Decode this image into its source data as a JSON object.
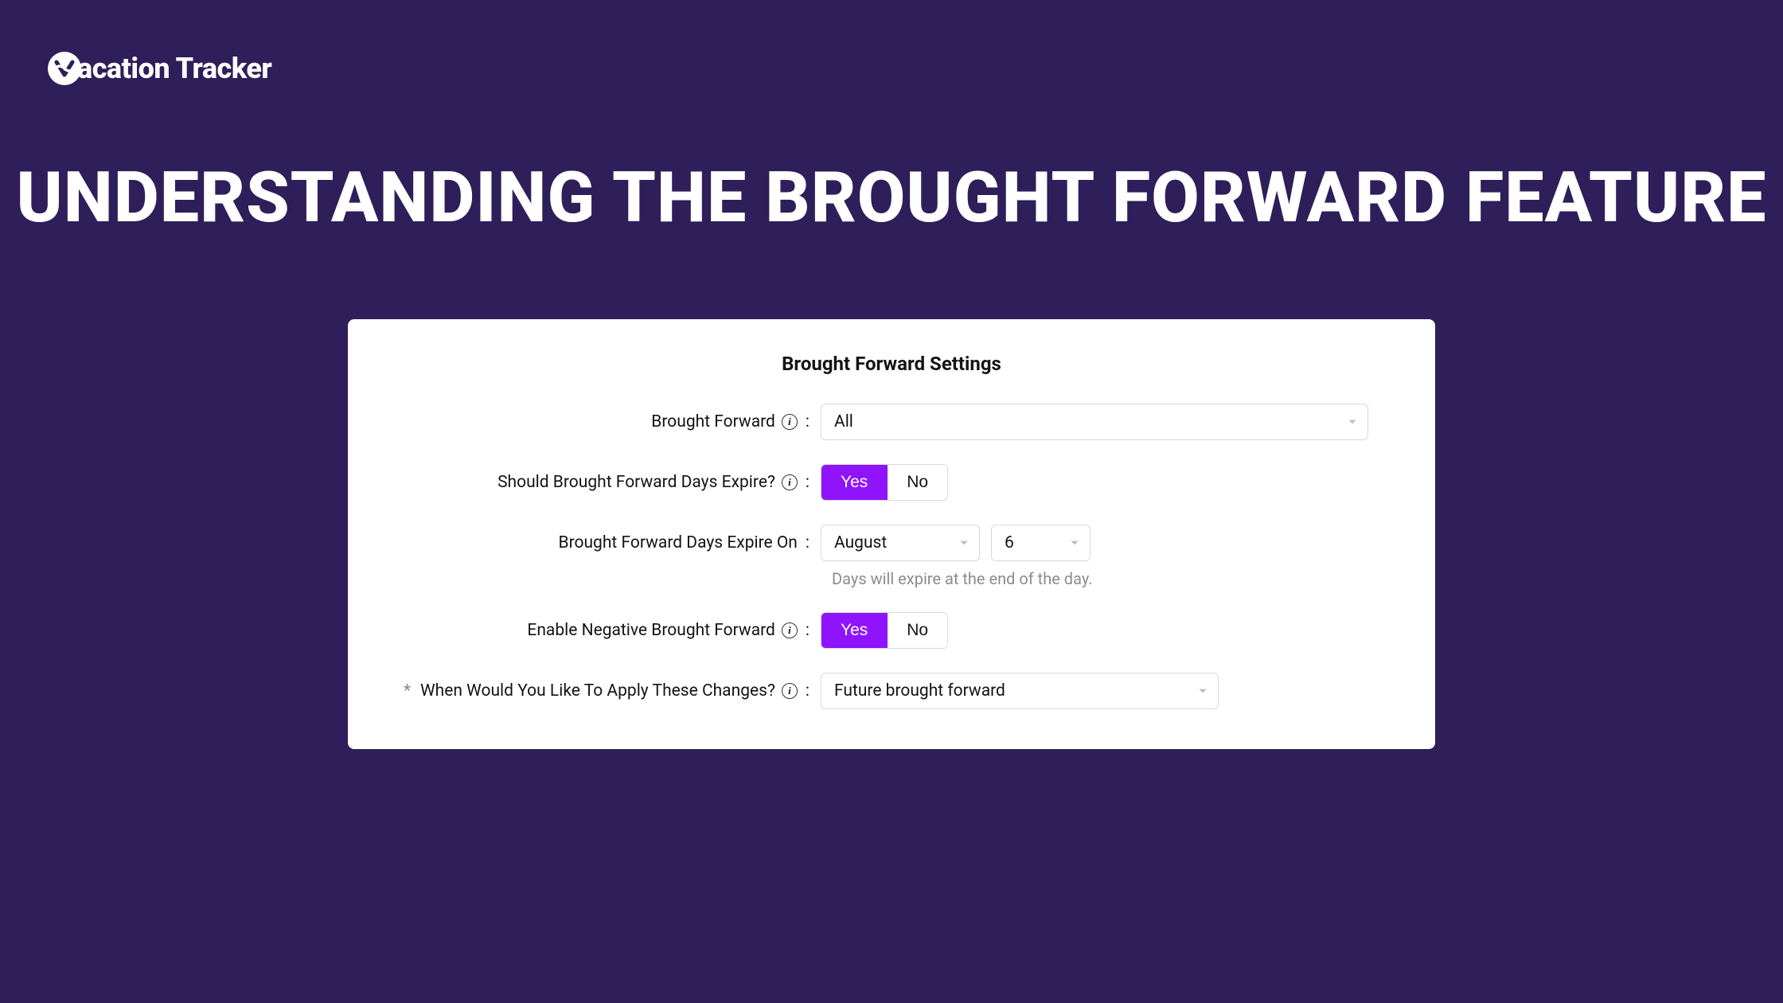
{
  "brand": {
    "name": "acation Tracker"
  },
  "title": "UNDERSTANDING THE BROUGHT FORWARD FEATURE",
  "card": {
    "heading": "Brought Forward Settings",
    "rows": {
      "broughtForward": {
        "label": "Brought Forward",
        "value": "All"
      },
      "shouldExpire": {
        "label": "Should Brought Forward Days Expire?",
        "yes": "Yes",
        "no": "No"
      },
      "expireOn": {
        "label": "Brought Forward Days Expire On",
        "month": "August",
        "day": "6",
        "helper": "Days will expire at the end of the day."
      },
      "enableNegative": {
        "label": "Enable Negative Brought Forward",
        "yes": "Yes",
        "no": "No"
      },
      "applyChanges": {
        "label": "When Would You Like To Apply These Changes?",
        "value": "Future brought forward"
      }
    }
  }
}
